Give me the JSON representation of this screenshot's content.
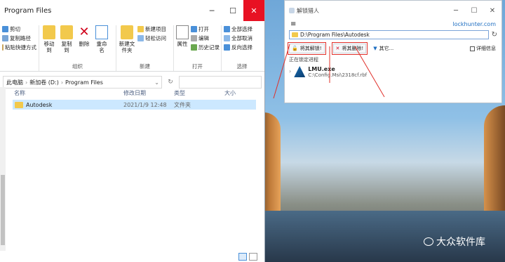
{
  "explorer": {
    "title": "Program Files",
    "ribbon": {
      "clipboard": {
        "cut": "剪切",
        "copy_path": "复制路径",
        "paste_shortcut": "粘贴快捷方式"
      },
      "organize": {
        "label": "组织",
        "move_to": "移动到",
        "copy_to": "复制到",
        "delete": "删除",
        "rename": "重命名"
      },
      "new": {
        "label": "新建",
        "new_item": "新建项目",
        "easy_access": "轻松访问",
        "new_folder": "新建文件夹"
      },
      "open": {
        "label": "打开",
        "properties": "属性",
        "open": "打开",
        "edit": "编辑",
        "history": "历史记录"
      },
      "select": {
        "label": "选择",
        "select_all": "全部选择",
        "select_none": "全部取消",
        "invert": "反向选择"
      }
    },
    "address": {
      "this_pc": "此电脑",
      "drive": "新加卷 (D:)",
      "folder": "Program Files"
    },
    "columns": {
      "name": "名称",
      "modified": "修改日期",
      "type": "类型",
      "size": "大小"
    },
    "files": [
      {
        "name": "Autodesk",
        "modified": "2021/1/9 12:48",
        "type": "文件夹",
        "size": ""
      }
    ]
  },
  "lockhunter": {
    "title": "解锁猎人",
    "site_link": "lockhunter.com",
    "path": "D:\\Program Files\\Autodesk",
    "actions": {
      "unlock": "将其解锁!",
      "delete": "将其删除!",
      "other": "其它..."
    },
    "details_label": "详细信息",
    "section_label": "正在锁定进程",
    "process": {
      "name": "LMU.exe",
      "path": "C:\\Config.Msi\\2318cf.rbf"
    }
  },
  "watermark": {
    "text": "大众软件库"
  },
  "colors": {
    "accent": "#1f6fc2",
    "selection": "#cce8ff",
    "highlight": "#e0302a",
    "close": "#e81123"
  }
}
